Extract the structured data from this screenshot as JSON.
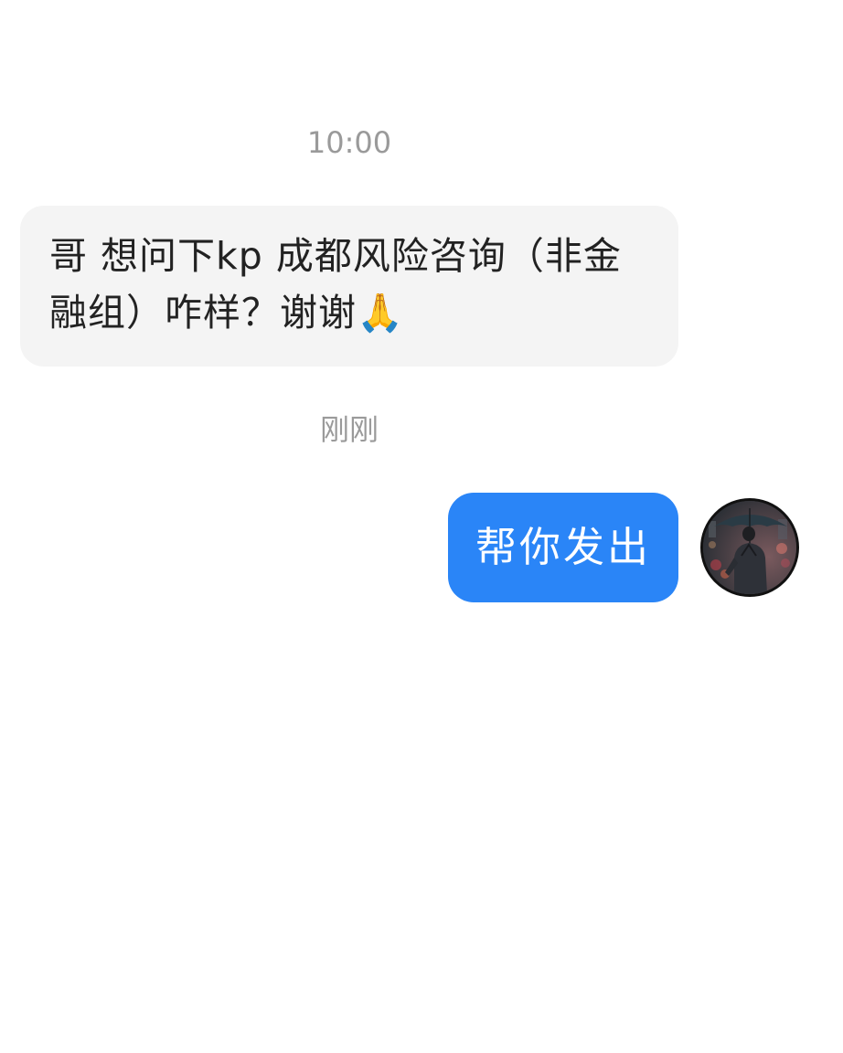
{
  "conversation": {
    "messages": [
      {
        "timestamp": "10:00",
        "direction": "incoming",
        "text": "哥 想问下kp 成都风险咨询（非金融组）咋样？谢谢🙏"
      },
      {
        "timestamp": "刚刚",
        "direction": "outgoing",
        "text": "帮你发出",
        "avatar_icon": "user-avatar-man-with-umbrella"
      }
    ]
  },
  "colors": {
    "background": "#ffffff",
    "incoming_bubble": "#f4f4f4",
    "outgoing_bubble": "#2a85f7",
    "timestamp_text": "#9a9a9a",
    "incoming_text": "#222222",
    "outgoing_text": "#ffffff"
  }
}
